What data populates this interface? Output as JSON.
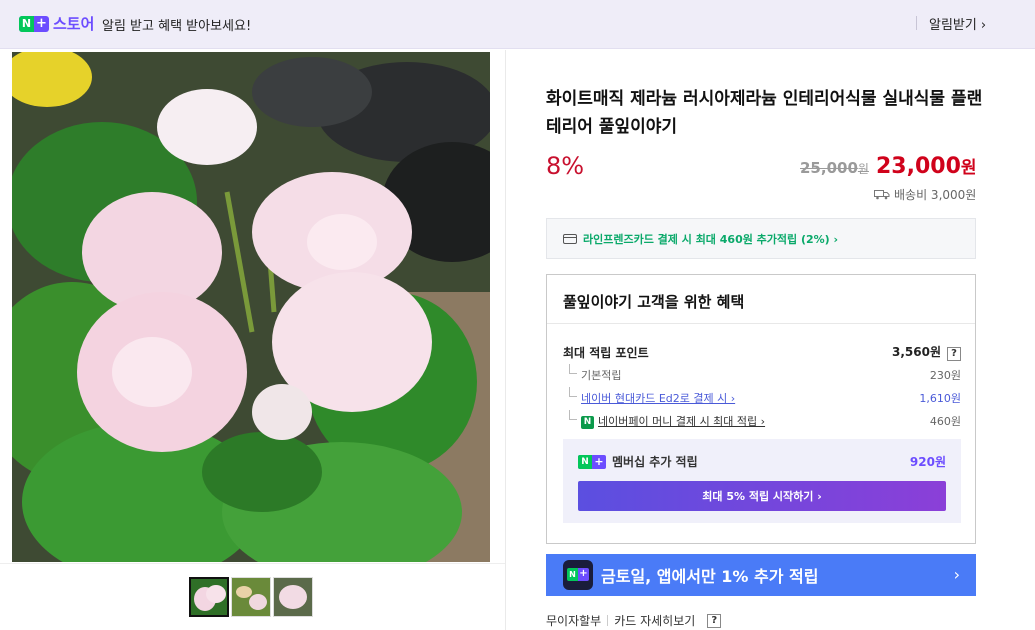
{
  "banner": {
    "brand_n": "N",
    "brand_plus": "+",
    "brand_name": "스토어",
    "message": "알림 받고 혜택 받아보세요!",
    "alarm_label": "알림받기",
    "alarm_chevron": "›"
  },
  "product": {
    "title": "화이트매직 제라늄 러시아제라늄 인테리어식물 실내식물 플랜테리어 풀잎이야기",
    "discount": "8%",
    "original_price": "25,000",
    "original_unit": "원",
    "price": "23,000",
    "price_unit": "원",
    "shipping": "배송비 3,000원",
    "shipping_icon": "truck-icon"
  },
  "card_promo": {
    "text": "라인프렌즈카드 결제 시 최대 460원 추가적립 (2%) ›",
    "icon": "credit-card-icon"
  },
  "benefits": {
    "title": "풀잎이야기 고객을 위한 혜택",
    "max_point_label": "최대 적립 포인트",
    "max_point_value": "3,560원",
    "help": "?",
    "rows": [
      {
        "label": "기본적립",
        "value": "230원"
      },
      {
        "label": "네이버 현대카드 Ed2로 결제 시 ›",
        "value": "1,610원"
      },
      {
        "label": "네이버페이 머니 결제 시 최대 적립 ›",
        "value": "460원",
        "badge": "N"
      }
    ],
    "member": {
      "label": "멤버십 추가 적립",
      "value": "920원",
      "button": "최대 5% 적립 시작하기 ›"
    }
  },
  "app_banner": {
    "text": "금토일, 앱에서만 1% 추가 적립",
    "chevron": "›"
  },
  "bottom": {
    "installment": "무이자할부",
    "card_details": "카드 자세히보기",
    "help": "?"
  },
  "colors": {
    "brand_purple": "#6c4dff",
    "naver_green": "#03c75a",
    "price_red": "#d0021b",
    "promo_green": "#0aa96a",
    "app_blue": "#4a7bf7"
  }
}
